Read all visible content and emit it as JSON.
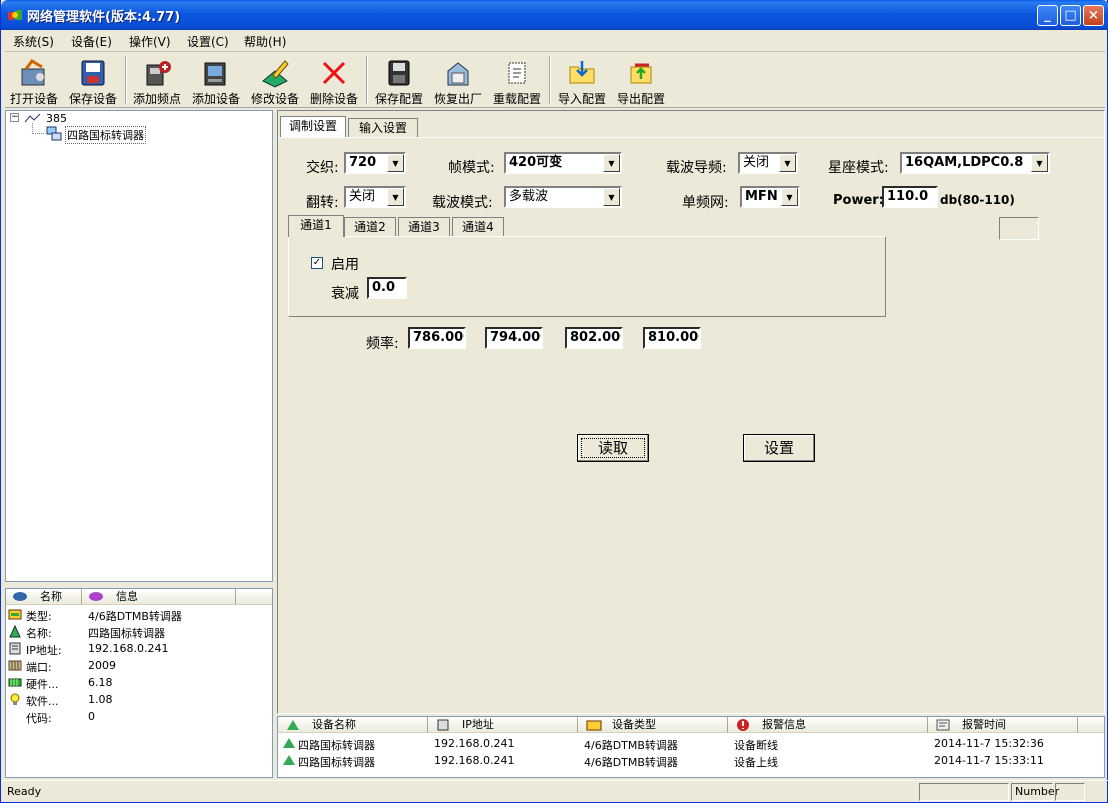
{
  "title": "网络管理软件(版本:4.77)",
  "window_buttons": {
    "minimize": "_",
    "maximize": "□",
    "close": "×"
  },
  "menu": [
    "系统(S)",
    "设备(E)",
    "操作(V)",
    "设置(C)",
    "帮助(H)"
  ],
  "toolbar": [
    {
      "label": "打开设备",
      "icon": "open-device-icon"
    },
    {
      "label": "保存设备",
      "icon": "save-device-icon"
    },
    {
      "label": "添加频点",
      "icon": "add-frequency-icon"
    },
    {
      "label": "添加设备",
      "icon": "add-device-icon"
    },
    {
      "label": "修改设备",
      "icon": "edit-device-icon"
    },
    {
      "label": "删除设备",
      "icon": "delete-device-icon"
    },
    {
      "label": "保存配置",
      "icon": "save-config-icon"
    },
    {
      "label": "恢复出厂",
      "icon": "restore-factory-icon"
    },
    {
      "label": "重载配置",
      "icon": "reload-config-icon"
    },
    {
      "label": "导入配置",
      "icon": "import-config-icon"
    },
    {
      "label": "导出配置",
      "icon": "export-config-icon"
    }
  ],
  "tree": {
    "root": "385",
    "child": "四路国标转调器"
  },
  "info": {
    "headers": [
      "名称",
      "信息"
    ],
    "rows": [
      {
        "name": "类型:",
        "value": "4/6路DTMB转调器"
      },
      {
        "name": "名称:",
        "value": "四路国标转调器"
      },
      {
        "name": "IP地址:",
        "value": "192.168.0.241"
      },
      {
        "name": "端口:",
        "value": "2009"
      },
      {
        "name": "硬件...",
        "value": "6.18"
      },
      {
        "name": "软件...",
        "value": "1.08"
      },
      {
        "name": "代码:",
        "value": "0"
      }
    ]
  },
  "tabs": [
    "调制设置",
    "输入设置"
  ],
  "form": {
    "interleave_label": "交织:",
    "interleave_value": "720",
    "frame_label": "帧模式:",
    "frame_value": "420可变",
    "pilot_label": "载波导频:",
    "pilot_value": "关闭",
    "constellation_label": "星座模式:",
    "constellation_value": "16QAM,LDPC0.8",
    "flip_label": "翻转:",
    "flip_value": "关闭",
    "carrier_label": "载波模式:",
    "carrier_value": "多载波",
    "sfn_label": "单频网:",
    "sfn_value": "MFN",
    "power_label": "Power:",
    "power_value": "110.0",
    "power_unit": "db(80-110)"
  },
  "channel_tabs": [
    "通道1",
    "通道2",
    "通道3",
    "通道4"
  ],
  "channel": {
    "enable_label": "启用",
    "enabled": true,
    "atten_label": "衰减",
    "atten_value": "0.0"
  },
  "freq": {
    "label": "频率:",
    "values": [
      "786.000",
      "794.000",
      "802.000",
      "810.000"
    ]
  },
  "buttons": {
    "read": "读取",
    "set": "设置"
  },
  "alarm": {
    "headers": [
      "设备名称",
      "IP地址",
      "设备类型",
      "报警信息",
      "报警时间"
    ],
    "rows": [
      {
        "name": "四路国标转调器",
        "ip": "192.168.0.241",
        "type": "4/6路DTMB转调器",
        "msg": "设备断线",
        "time": "2014-11-7 15:32:36"
      },
      {
        "name": "四路国标转调器",
        "ip": "192.168.0.241",
        "type": "4/6路DTMB转调器",
        "msg": "设备上线",
        "time": "2014-11-7 15:33:11"
      }
    ]
  },
  "status": {
    "text": "Ready",
    "number": "Number"
  }
}
